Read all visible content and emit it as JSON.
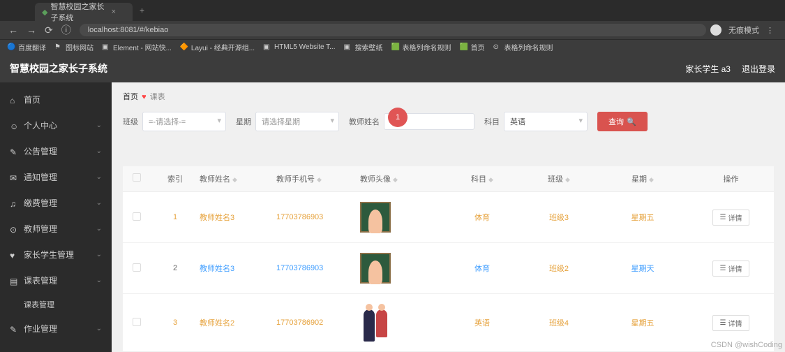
{
  "browser": {
    "tab_title": "智慧校园之家长子系统",
    "newtab": "+",
    "url": "localhost:8081/#/kebiao",
    "info_icon": "ⓘ",
    "profile_label": "无痕模式",
    "menu": "⋮"
  },
  "bookmarks": [
    "百度翻译",
    "图标网站",
    "Element - 网站快...",
    "Layui - 经典开源组...",
    "HTML5 Website T...",
    "搜索壁纸",
    "表格列命名规则",
    "首页",
    "表格列命名规则"
  ],
  "header": {
    "title": "智慧校园之家长子系统",
    "user": "家长学生 a3",
    "logout": "退出登录"
  },
  "sidebar": [
    {
      "icon": "⌂",
      "label": "首页",
      "chev": false
    },
    {
      "icon": "☺",
      "label": "个人中心",
      "chev": true
    },
    {
      "icon": "✎",
      "label": "公告管理",
      "chev": true
    },
    {
      "icon": "✉",
      "label": "通知管理",
      "chev": true
    },
    {
      "icon": "♫",
      "label": "缴费管理",
      "chev": true
    },
    {
      "icon": "⊙",
      "label": "教师管理",
      "chev": true
    },
    {
      "icon": "♥",
      "label": "家长学生管理",
      "chev": true
    },
    {
      "icon": "▤",
      "label": "课表管理",
      "chev": true,
      "open": true,
      "sub": [
        "课表管理"
      ]
    },
    {
      "icon": "✎",
      "label": "作业管理",
      "chev": true
    }
  ],
  "breadcrumb": {
    "home": "首页",
    "current": "课表"
  },
  "filters": {
    "class_label": "班级",
    "class_placeholder": "=-请选择-=",
    "week_label": "星期",
    "week_placeholder": "请选择星期",
    "teacher_label": "教师姓名",
    "teacher_placeholder": "教",
    "subject_label": "科目",
    "subject_value": "英语",
    "search_btn": "查询"
  },
  "table": {
    "headers": [
      "索引",
      "教师姓名",
      "教师手机号",
      "教师头像",
      "科目",
      "班级",
      "星期",
      "操作"
    ],
    "rows": [
      {
        "idx": "1",
        "idx_c": "o",
        "name": "教师姓名3",
        "name_c": "o",
        "phone": "17703786903",
        "phone_c": "o",
        "avatar": "board",
        "subj": "体育",
        "subj_c": "o",
        "cls": "班级3",
        "cls_c": "o",
        "week": "星期五",
        "week_c": "o",
        "op": "详情"
      },
      {
        "idx": "2",
        "idx_c": "n",
        "name": "教师姓名3",
        "name_c": "b",
        "phone": "17703786903",
        "phone_c": "b",
        "avatar": "board",
        "subj": "体育",
        "subj_c": "b",
        "cls": "班级2",
        "cls_c": "o",
        "week": "星期天",
        "week_c": "b",
        "op": "详情"
      },
      {
        "idx": "3",
        "idx_c": "o",
        "name": "教师姓名2",
        "name_c": "o",
        "phone": "17703786902",
        "phone_c": "o",
        "avatar": "people",
        "subj": "英语",
        "subj_c": "o",
        "cls": "班级4",
        "cls_c": "o",
        "week": "星期五",
        "week_c": "o",
        "op": "详情"
      }
    ]
  },
  "click_marker": "1",
  "watermark": "CSDN @wishCoding"
}
